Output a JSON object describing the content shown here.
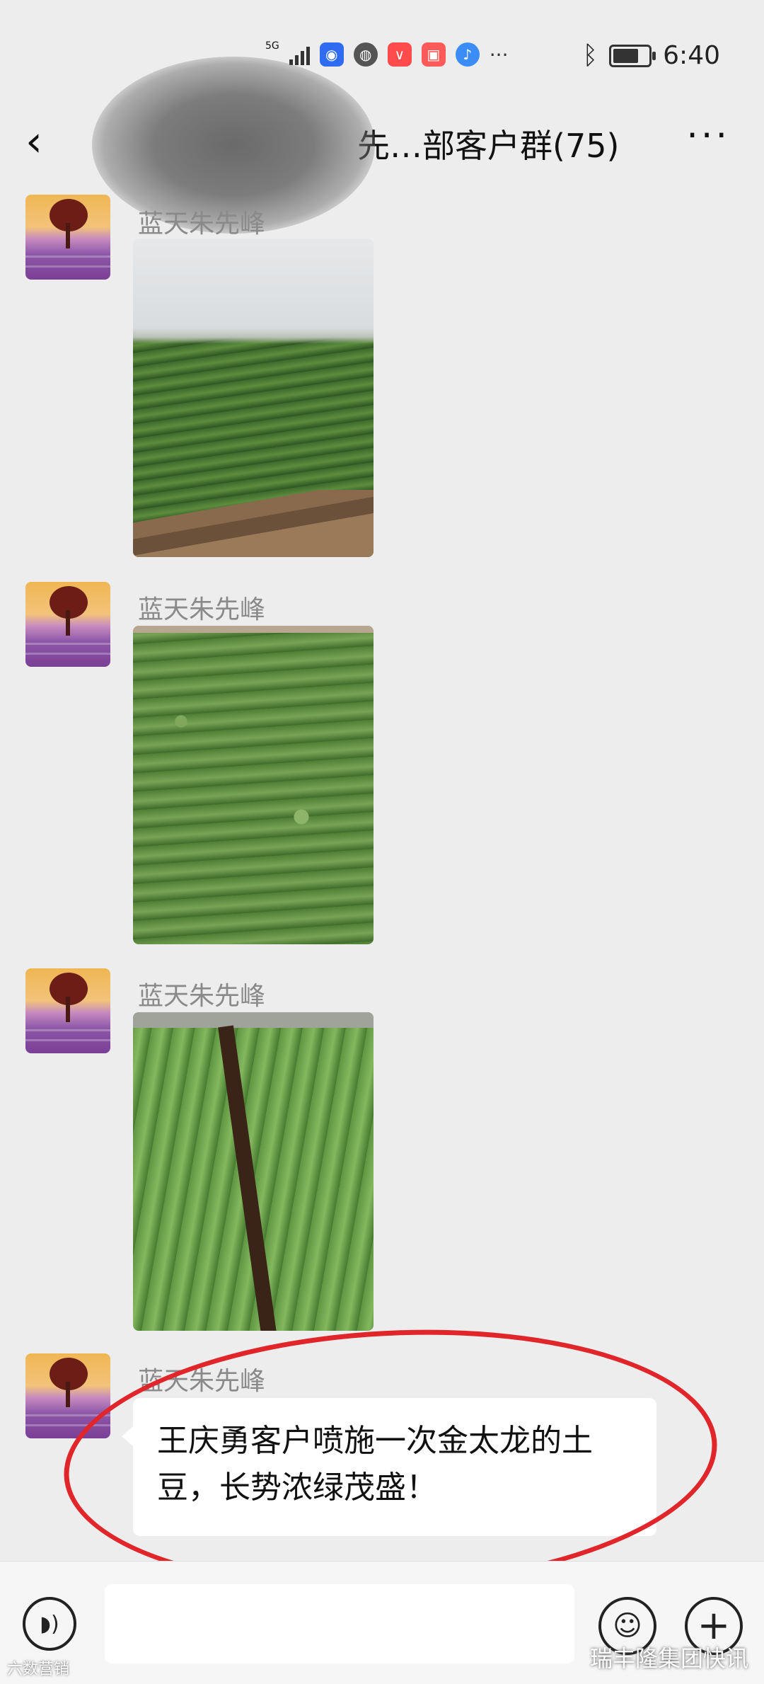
{
  "status_bar": {
    "network": "5G",
    "time": "6:40",
    "notification_icons": [
      "qq-icon",
      "browser-icon",
      "video-icon",
      "red-app-icon",
      "music-icon"
    ],
    "more_indicator": "···",
    "battery_level": 0.8
  },
  "header": {
    "back_label": "‹",
    "title": "先…部客户群(75)",
    "more_label": "···"
  },
  "messages": [
    {
      "type": "image",
      "sender": "蓝天朱先峰"
    },
    {
      "type": "image",
      "sender": "蓝天朱先峰"
    },
    {
      "type": "image",
      "sender": "蓝天朱先峰"
    },
    {
      "type": "text",
      "sender": "蓝天朱先峰",
      "text": "王庆勇客户喷施一次金太龙的土豆，长势浓绿茂盛！"
    }
  ],
  "input_bar": {
    "voice_icon": "voice-icon",
    "text_value": "",
    "emoji_icon": "emoji-icon",
    "plus_icon": "plus-icon"
  },
  "watermarks": {
    "left": "六数营销",
    "right": "瑞丰隆集团快讯"
  },
  "colors": {
    "background": "#ededed",
    "annotation": "#e0262a",
    "sender_name": "#8a8a8a"
  }
}
